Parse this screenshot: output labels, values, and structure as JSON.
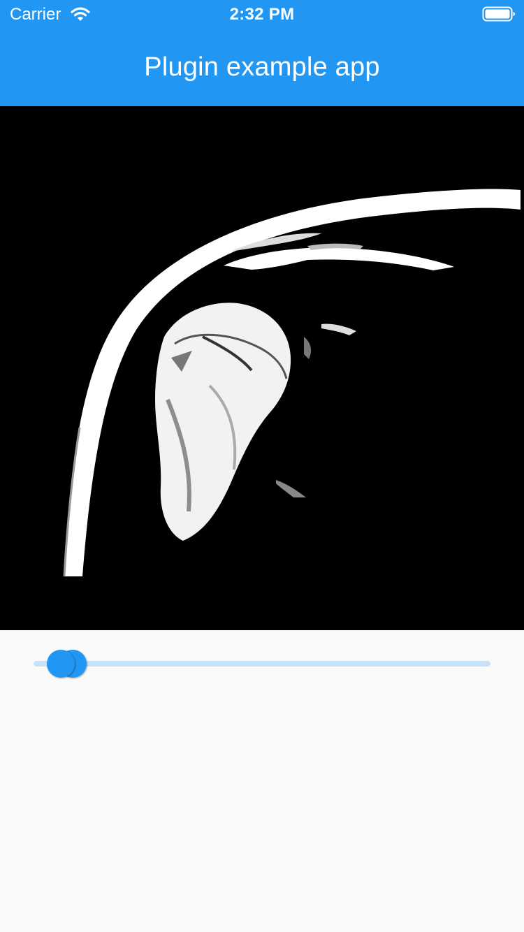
{
  "status_bar": {
    "carrier": "Carrier",
    "time": "2:32 PM",
    "wifi_icon": "wifi-icon",
    "battery_icon": "battery-icon"
  },
  "app_bar": {
    "title": "Plugin example app",
    "color": "#2196f3"
  },
  "viewer": {
    "background": "#000000",
    "content": "grayscale MRI image of a shoulder joint"
  },
  "range_slider": {
    "min_value": 0.06,
    "max_value": 0.085,
    "accent_color": "#2196f3",
    "inactive_color": "#c7e1f8"
  }
}
